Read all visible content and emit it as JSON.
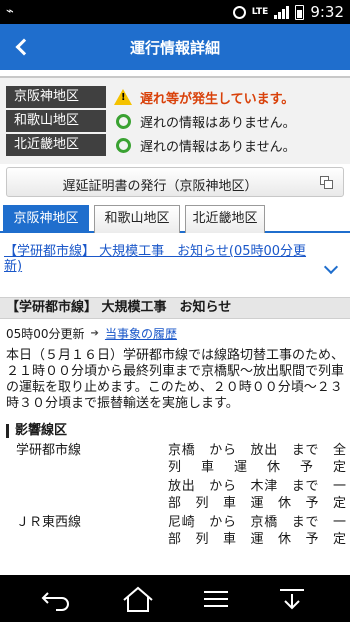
{
  "status_bar": {
    "time": "9:32",
    "network": "LTE",
    "battery": "67"
  },
  "header": {
    "title": "運行情報詳細"
  },
  "status_rows": [
    {
      "region": "京阪神地区",
      "icon": "warning-icon",
      "text": "遅れ等が発生しています。",
      "alert": true
    },
    {
      "region": "和歌山地区",
      "icon": "ok-circle-icon",
      "text": "遅れの情報はありません。",
      "alert": false
    },
    {
      "region": "北近畿地区",
      "icon": "ok-circle-icon",
      "text": "遅れの情報はありません。",
      "alert": false
    }
  ],
  "certificate_button": {
    "label": "遅延証明書の発行（京阪神地区）",
    "icon": "copy-icon"
  },
  "tabs": [
    {
      "label": "京阪神地区",
      "active": true
    },
    {
      "label": "和歌山地区",
      "active": false
    },
    {
      "label": "北近畿地区",
      "active": false
    }
  ],
  "news_link": {
    "text": "【学研都市線】 大規模工事　お知らせ(05時00分更新)"
  },
  "detail": {
    "heading": "【学研都市線】 大規模工事　お知らせ",
    "updated": "05時00分更新",
    "history_link": "当事象の履歴",
    "body": "本日（５月１６日）学研都市線では線路切替工事のため、２１時００分頃から最終列車まで京橋駅～放出駅間で列車の運転を取り止めます。このため、２０時００分頃～２３時３０分頃まで振替輸送を実施します。",
    "affected_heading": "影響線区",
    "affected": [
      {
        "line": "学研都市線",
        "desc": "京橋　から　放出　まで　全列車運休予定"
      },
      {
        "line": "",
        "desc": "放出　から　木津　まで　一部列車運休予定"
      },
      {
        "line": "ＪＲ東西線",
        "desc": "尼崎　から　京橋　まで　一部列車運休予定"
      }
    ]
  },
  "colors": {
    "brand_blue": "#1f6ecd",
    "alert_orange": "#d9410a",
    "ok_green": "#3aa232",
    "warning_yellow": "#f5c200"
  }
}
